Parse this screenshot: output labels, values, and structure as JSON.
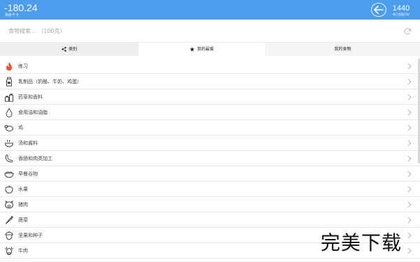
{
  "header": {
    "left_value": "-180.24",
    "left_sublabel": "剩余千卡",
    "right_value": "1440",
    "right_sublabel": "每日热量目标"
  },
  "search": {
    "placeholder": "食物搜索... （100克）"
  },
  "tabs": [
    {
      "label": "类别",
      "icon": "share-icon"
    },
    {
      "label": "我的最爱",
      "icon": "star-icon"
    },
    {
      "label": "我的食物",
      "icon": ""
    }
  ],
  "categories": [
    {
      "label": "练习",
      "icon": "flame-icon"
    },
    {
      "label": "乳制品（奶酪、牛奶、鸡蛋）",
      "icon": "milk-bottle-icon"
    },
    {
      "label": "药草和香料",
      "icon": "spice-jars-icon"
    },
    {
      "label": "食用油和油脂",
      "icon": "oil-drop-icon"
    },
    {
      "label": "鸡",
      "icon": "chicken-icon"
    },
    {
      "label": "汤和酱料",
      "icon": "soup-bowl-icon"
    },
    {
      "label": "香肠和肉类加工",
      "icon": "sausage-icon"
    },
    {
      "label": "早餐谷物",
      "icon": "cereal-bowl-icon"
    },
    {
      "label": "水果",
      "icon": "apple-icon"
    },
    {
      "label": "猪肉",
      "icon": "pig-icon"
    },
    {
      "label": "蔬菜",
      "icon": "carrot-icon"
    },
    {
      "label": "坚果和种子",
      "icon": "acorn-icon"
    },
    {
      "label": "牛肉",
      "icon": "cow-icon"
    }
  ],
  "watermark": "完美下载",
  "colors": {
    "header_bg": "#4d9ded",
    "flame": "#e8502f"
  }
}
